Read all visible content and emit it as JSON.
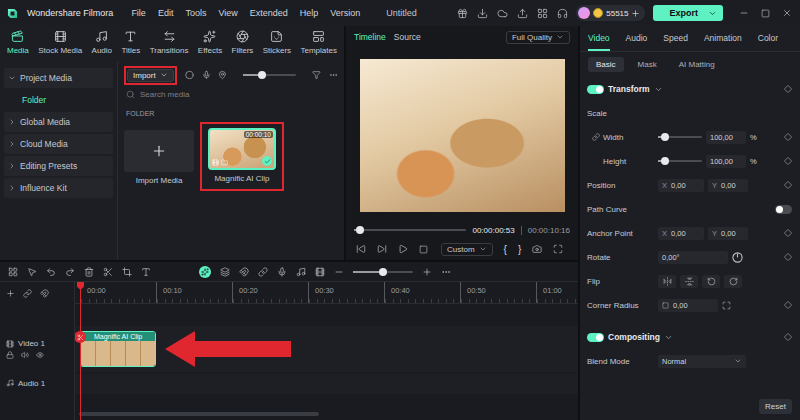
{
  "titleBar": {
    "appName": "Wondershare Filmora",
    "menu": [
      "File",
      "Edit",
      "Tools",
      "View",
      "Extended",
      "Help",
      "Version"
    ],
    "project": "Untitled",
    "credits": "55515",
    "export": "Export"
  },
  "mediaTabs": [
    {
      "label": "Media",
      "selected": true
    },
    {
      "label": "Stock Media",
      "selected": false
    },
    {
      "label": "Audio",
      "selected": false
    },
    {
      "label": "Titles",
      "selected": false
    },
    {
      "label": "Transitions",
      "selected": false
    },
    {
      "label": "Effects",
      "selected": false
    },
    {
      "label": "Filters",
      "selected": false
    },
    {
      "label": "Stickers",
      "selected": false
    },
    {
      "label": "Templates",
      "selected": false
    }
  ],
  "sidebar": [
    {
      "label": "Project Media",
      "kind": "group",
      "expanded": true,
      "selected": false
    },
    {
      "label": "Folder",
      "kind": "child",
      "expanded": false,
      "selected": true
    },
    {
      "label": "Global Media",
      "kind": "group",
      "expanded": false,
      "selected": false
    },
    {
      "label": "Cloud Media",
      "kind": "group",
      "expanded": false,
      "selected": false
    },
    {
      "label": "Editing Presets",
      "kind": "group",
      "expanded": false,
      "selected": false
    },
    {
      "label": "Influence Kit",
      "kind": "group",
      "expanded": false,
      "selected": false
    }
  ],
  "mediaToolbar": {
    "import": "Import",
    "highlighted": true,
    "zoom": 0.35,
    "search": "Search media"
  },
  "folder": {
    "label": "FOLDER",
    "importCard": {
      "label": "Import Media"
    },
    "clips": [
      {
        "label": "Magnific AI Clip",
        "duration": "00:00:10",
        "selected": true,
        "highlighted": true
      }
    ]
  },
  "player": {
    "tabs": [
      {
        "label": "Timeline",
        "selected": true
      },
      {
        "label": "Source",
        "selected": false
      }
    ],
    "quality": "Full Quality",
    "current": "00:00:00:53",
    "total": "00:00:10:16",
    "progress": 0.05,
    "ratio": "Custom",
    "markIn": "{",
    "markOut": "}"
  },
  "inspector": {
    "tabs": [
      {
        "label": "Video",
        "selected": true
      },
      {
        "label": "Audio",
        "selected": false
      },
      {
        "label": "Speed",
        "selected": false
      },
      {
        "label": "Animation",
        "selected": false
      },
      {
        "label": "Color",
        "selected": false
      }
    ],
    "subTabs": [
      {
        "label": "Basic",
        "selected": true
      },
      {
        "label": "Mask",
        "selected": false
      },
      {
        "label": "AI Matting",
        "selected": false
      }
    ],
    "rows": [
      {
        "kind": "section",
        "label": "Transform",
        "on": true,
        "expanded": true
      },
      {
        "kind": "heading",
        "label": "Scale"
      },
      {
        "kind": "slider",
        "label": "Width",
        "value": "100,00",
        "unit": "%",
        "level": 0.15
      },
      {
        "kind": "slider",
        "label": "Height",
        "value": "100,00",
        "unit": "%",
        "level": 0.15
      },
      {
        "kind": "xy",
        "label": "Position",
        "xLabel": "X",
        "x": "0,00",
        "yLabel": "Y",
        "y": "0,00"
      },
      {
        "kind": "toggle",
        "label": "Path Curve",
        "on": false
      },
      {
        "kind": "xy",
        "label": "Anchor Point",
        "xLabel": "X",
        "x": "0,00",
        "yLabel": "Y",
        "y": "0,00"
      },
      {
        "kind": "angle",
        "label": "Rotate",
        "value": "0,00°"
      },
      {
        "kind": "flip",
        "label": "Flip"
      },
      {
        "kind": "radius",
        "label": "Corner Radius",
        "value": "0,00"
      },
      {
        "kind": "section",
        "label": "Compositing",
        "on": true,
        "expanded": true
      },
      {
        "kind": "select",
        "label": "Blend Mode",
        "value": "Normal"
      }
    ],
    "reset": "Reset"
  },
  "timeline": {
    "ruler": [
      "00:00",
      "00:10",
      "00:20",
      "00:30",
      "00:40",
      "00:50",
      "01:00"
    ],
    "zoom": 0.5,
    "videoTrack": {
      "label": "Video 1",
      "clip": "Magnific AI Clip"
    },
    "audioTrack": {
      "label": "Audio 1"
    },
    "arrowToClip": true
  }
}
